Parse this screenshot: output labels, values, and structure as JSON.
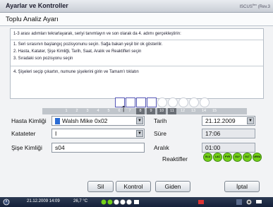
{
  "window": {
    "title": "Ayarlar ve Kontroller",
    "brand": "ISCUS",
    "brand_sup": "flex",
    "brand_suffix": "(Rev.3"
  },
  "header": {
    "subtitle": "Toplu Analiz Ayarı"
  },
  "instructions": {
    "intro": "1-3 arası adımları tekrarlayarak, seriyi tanımlayın ve son olarak da 4. adımı gerçekleştirin:",
    "step1": "1. Seri sırasının başlangıç pozisyonunu seçin. Sağa bakan yeşil bir ok gösterilir.",
    "step2": "2. Hasta, Katater, Şişe Kimliği, Tarih, Saat, Aralık ve Reaktifleri seçin",
    "step3": "3. Sıradaki son pozisyonu seçin",
    "step4": "4. Şişeleri seçip çıkartın, numune şişelerini girin ve Tamam'ı tıklatın"
  },
  "sample_positions": {
    "numbers": [
      "1",
      "2",
      "3",
      "4",
      "5",
      "6",
      "7",
      "8",
      "9",
      "10",
      "11",
      "12",
      "13",
      "14",
      "15"
    ],
    "selected_from": 8,
    "selected_to": 11,
    "current_marker": "10"
  },
  "form": {
    "patient_label": "Hasta Kimliği",
    "patient_value": "Walsh Mike 0x02",
    "catheter_label": "Katateter",
    "catheter_value": "I",
    "vial_label": "Şişe Kimliği",
    "vial_value": "s04",
    "date_label": "Tarih",
    "date_value": "21.12.2009",
    "duration_label": "Süre",
    "duration_value": "17:06",
    "interval_label": "Aralık",
    "interval_value": "01:00",
    "reagents_label": "Reaktifler",
    "reagents": [
      "GLU",
      "LAC",
      "PYR",
      "GLY",
      "GLT",
      "UREA"
    ]
  },
  "buttons": {
    "delete": "Sil",
    "control": "Kontrol",
    "go": "Giden",
    "cancel": "İptal"
  },
  "taskbar": {
    "datetime": "21.12.2009 14:09",
    "temperature": "26,7 °C"
  },
  "colors": {
    "accent": "#2b6cd4",
    "reagent_green": "#74d018"
  }
}
